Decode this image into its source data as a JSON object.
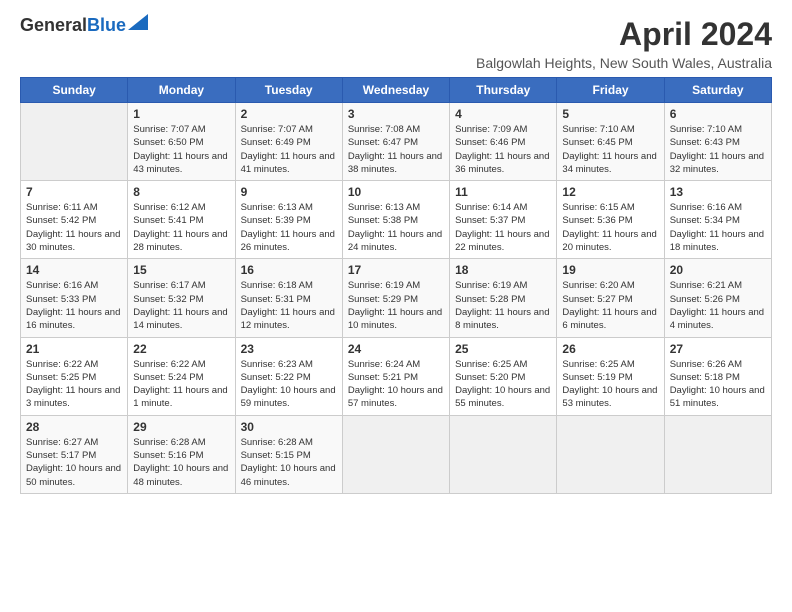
{
  "header": {
    "logo_line1": "General",
    "logo_line2": "Blue",
    "month": "April 2024",
    "location": "Balgowlah Heights, New South Wales, Australia"
  },
  "weekdays": [
    "Sunday",
    "Monday",
    "Tuesday",
    "Wednesday",
    "Thursday",
    "Friday",
    "Saturday"
  ],
  "weeks": [
    [
      {
        "day": "",
        "sunrise": "",
        "sunset": "",
        "daylight": ""
      },
      {
        "day": "1",
        "sunrise": "Sunrise: 7:07 AM",
        "sunset": "Sunset: 6:50 PM",
        "daylight": "Daylight: 11 hours and 43 minutes."
      },
      {
        "day": "2",
        "sunrise": "Sunrise: 7:07 AM",
        "sunset": "Sunset: 6:49 PM",
        "daylight": "Daylight: 11 hours and 41 minutes."
      },
      {
        "day": "3",
        "sunrise": "Sunrise: 7:08 AM",
        "sunset": "Sunset: 6:47 PM",
        "daylight": "Daylight: 11 hours and 38 minutes."
      },
      {
        "day": "4",
        "sunrise": "Sunrise: 7:09 AM",
        "sunset": "Sunset: 6:46 PM",
        "daylight": "Daylight: 11 hours and 36 minutes."
      },
      {
        "day": "5",
        "sunrise": "Sunrise: 7:10 AM",
        "sunset": "Sunset: 6:45 PM",
        "daylight": "Daylight: 11 hours and 34 minutes."
      },
      {
        "day": "6",
        "sunrise": "Sunrise: 7:10 AM",
        "sunset": "Sunset: 6:43 PM",
        "daylight": "Daylight: 11 hours and 32 minutes."
      }
    ],
    [
      {
        "day": "7",
        "sunrise": "Sunrise: 6:11 AM",
        "sunset": "Sunset: 5:42 PM",
        "daylight": "Daylight: 11 hours and 30 minutes."
      },
      {
        "day": "8",
        "sunrise": "Sunrise: 6:12 AM",
        "sunset": "Sunset: 5:41 PM",
        "daylight": "Daylight: 11 hours and 28 minutes."
      },
      {
        "day": "9",
        "sunrise": "Sunrise: 6:13 AM",
        "sunset": "Sunset: 5:39 PM",
        "daylight": "Daylight: 11 hours and 26 minutes."
      },
      {
        "day": "10",
        "sunrise": "Sunrise: 6:13 AM",
        "sunset": "Sunset: 5:38 PM",
        "daylight": "Daylight: 11 hours and 24 minutes."
      },
      {
        "day": "11",
        "sunrise": "Sunrise: 6:14 AM",
        "sunset": "Sunset: 5:37 PM",
        "daylight": "Daylight: 11 hours and 22 minutes."
      },
      {
        "day": "12",
        "sunrise": "Sunrise: 6:15 AM",
        "sunset": "Sunset: 5:36 PM",
        "daylight": "Daylight: 11 hours and 20 minutes."
      },
      {
        "day": "13",
        "sunrise": "Sunrise: 6:16 AM",
        "sunset": "Sunset: 5:34 PM",
        "daylight": "Daylight: 11 hours and 18 minutes."
      }
    ],
    [
      {
        "day": "14",
        "sunrise": "Sunrise: 6:16 AM",
        "sunset": "Sunset: 5:33 PM",
        "daylight": "Daylight: 11 hours and 16 minutes."
      },
      {
        "day": "15",
        "sunrise": "Sunrise: 6:17 AM",
        "sunset": "Sunset: 5:32 PM",
        "daylight": "Daylight: 11 hours and 14 minutes."
      },
      {
        "day": "16",
        "sunrise": "Sunrise: 6:18 AM",
        "sunset": "Sunset: 5:31 PM",
        "daylight": "Daylight: 11 hours and 12 minutes."
      },
      {
        "day": "17",
        "sunrise": "Sunrise: 6:19 AM",
        "sunset": "Sunset: 5:29 PM",
        "daylight": "Daylight: 11 hours and 10 minutes."
      },
      {
        "day": "18",
        "sunrise": "Sunrise: 6:19 AM",
        "sunset": "Sunset: 5:28 PM",
        "daylight": "Daylight: 11 hours and 8 minutes."
      },
      {
        "day": "19",
        "sunrise": "Sunrise: 6:20 AM",
        "sunset": "Sunset: 5:27 PM",
        "daylight": "Daylight: 11 hours and 6 minutes."
      },
      {
        "day": "20",
        "sunrise": "Sunrise: 6:21 AM",
        "sunset": "Sunset: 5:26 PM",
        "daylight": "Daylight: 11 hours and 4 minutes."
      }
    ],
    [
      {
        "day": "21",
        "sunrise": "Sunrise: 6:22 AM",
        "sunset": "Sunset: 5:25 PM",
        "daylight": "Daylight: 11 hours and 3 minutes."
      },
      {
        "day": "22",
        "sunrise": "Sunrise: 6:22 AM",
        "sunset": "Sunset: 5:24 PM",
        "daylight": "Daylight: 11 hours and 1 minute."
      },
      {
        "day": "23",
        "sunrise": "Sunrise: 6:23 AM",
        "sunset": "Sunset: 5:22 PM",
        "daylight": "Daylight: 10 hours and 59 minutes."
      },
      {
        "day": "24",
        "sunrise": "Sunrise: 6:24 AM",
        "sunset": "Sunset: 5:21 PM",
        "daylight": "Daylight: 10 hours and 57 minutes."
      },
      {
        "day": "25",
        "sunrise": "Sunrise: 6:25 AM",
        "sunset": "Sunset: 5:20 PM",
        "daylight": "Daylight: 10 hours and 55 minutes."
      },
      {
        "day": "26",
        "sunrise": "Sunrise: 6:25 AM",
        "sunset": "Sunset: 5:19 PM",
        "daylight": "Daylight: 10 hours and 53 minutes."
      },
      {
        "day": "27",
        "sunrise": "Sunrise: 6:26 AM",
        "sunset": "Sunset: 5:18 PM",
        "daylight": "Daylight: 10 hours and 51 minutes."
      }
    ],
    [
      {
        "day": "28",
        "sunrise": "Sunrise: 6:27 AM",
        "sunset": "Sunset: 5:17 PM",
        "daylight": "Daylight: 10 hours and 50 minutes."
      },
      {
        "day": "29",
        "sunrise": "Sunrise: 6:28 AM",
        "sunset": "Sunset: 5:16 PM",
        "daylight": "Daylight: 10 hours and 48 minutes."
      },
      {
        "day": "30",
        "sunrise": "Sunrise: 6:28 AM",
        "sunset": "Sunset: 5:15 PM",
        "daylight": "Daylight: 10 hours and 46 minutes."
      },
      {
        "day": "",
        "sunrise": "",
        "sunset": "",
        "daylight": ""
      },
      {
        "day": "",
        "sunrise": "",
        "sunset": "",
        "daylight": ""
      },
      {
        "day": "",
        "sunrise": "",
        "sunset": "",
        "daylight": ""
      },
      {
        "day": "",
        "sunrise": "",
        "sunset": "",
        "daylight": ""
      }
    ]
  ]
}
